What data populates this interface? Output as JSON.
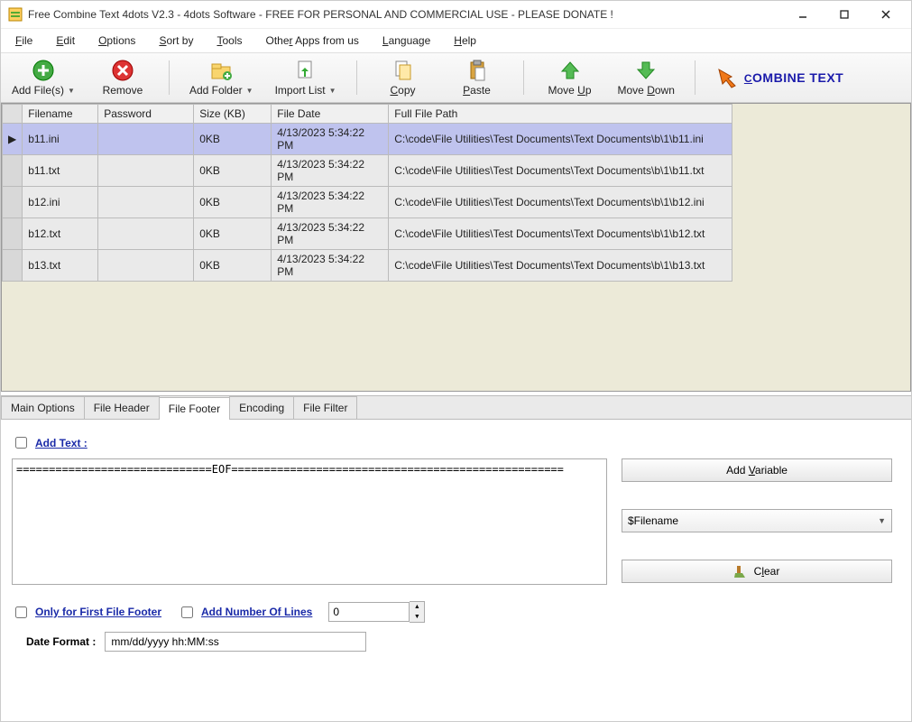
{
  "window": {
    "title": "Free Combine Text 4dots V2.3 - 4dots Software - FREE FOR PERSONAL AND COMMERCIAL USE - PLEASE DONATE !"
  },
  "menu": {
    "file": "File",
    "edit": "Edit",
    "options": "Options",
    "sortby": "Sort by",
    "tools": "Tools",
    "otherapps": "Other Apps from us",
    "language": "Language",
    "help": "Help"
  },
  "toolbar": {
    "addfiles": "Add File(s)",
    "remove": "Remove",
    "addfolder": "Add Folder",
    "importlist": "Import List",
    "copy": "Copy",
    "paste": "Paste",
    "moveup": "Move Up",
    "movedown": "Move Down",
    "combine": "COMBINE TEXT"
  },
  "columns": {
    "filename": "Filename",
    "password": "Password",
    "size": "Size (KB)",
    "date": "File Date",
    "path": "Full File Path"
  },
  "rows": [
    {
      "filename": "b11.ini",
      "password": "",
      "size": "0KB",
      "date": "4/13/2023 5:34:22 PM",
      "path": "C:\\code\\File Utilities\\Test Documents\\Text Documents\\b\\1\\b11.ini"
    },
    {
      "filename": "b11.txt",
      "password": "",
      "size": "0KB",
      "date": "4/13/2023 5:34:22 PM",
      "path": "C:\\code\\File Utilities\\Test Documents\\Text Documents\\b\\1\\b11.txt"
    },
    {
      "filename": "b12.ini",
      "password": "",
      "size": "0KB",
      "date": "4/13/2023 5:34:22 PM",
      "path": "C:\\code\\File Utilities\\Test Documents\\Text Documents\\b\\1\\b12.ini"
    },
    {
      "filename": "b12.txt",
      "password": "",
      "size": "0KB",
      "date": "4/13/2023 5:34:22 PM",
      "path": "C:\\code\\File Utilities\\Test Documents\\Text Documents\\b\\1\\b12.txt"
    },
    {
      "filename": "b13.txt",
      "password": "",
      "size": "0KB",
      "date": "4/13/2023 5:34:22 PM",
      "path": "C:\\code\\File Utilities\\Test Documents\\Text Documents\\b\\1\\b13.txt"
    }
  ],
  "tabs": {
    "main": "Main Options",
    "header": "File Header",
    "footer": "File Footer",
    "encoding": "Encoding",
    "filter": "File Filter"
  },
  "footerPanel": {
    "addText": "Add Text :",
    "textarea": "==============================EOF===================================================",
    "addVariable": "Add Variable",
    "variableSelected": "$Filename",
    "clear": "Clear",
    "onlyFirst": "Only for First File Footer",
    "addLines": "Add Number Of Lines",
    "linesValue": "0",
    "dateFormatLabel": "Date Format :",
    "dateFormatValue": "mm/dd/yyyy hh:MM:ss"
  }
}
